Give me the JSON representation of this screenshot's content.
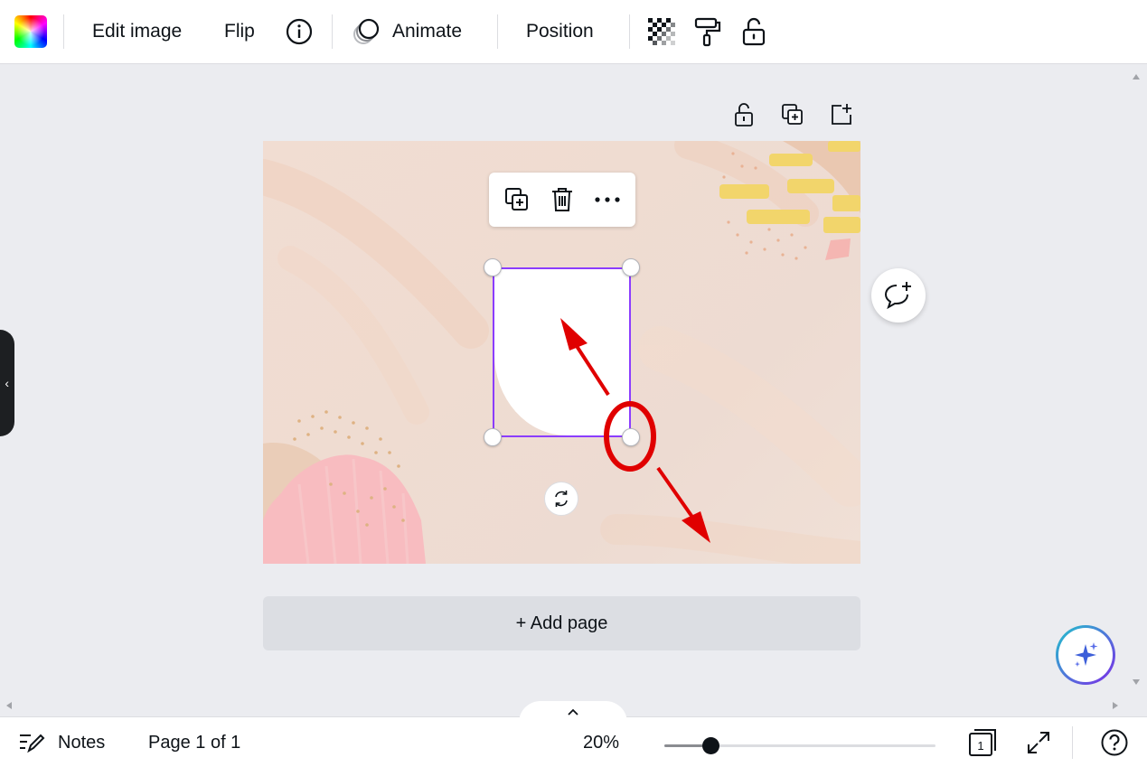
{
  "toolbar": {
    "edit_image": "Edit image",
    "flip": "Flip",
    "animate": "Animate",
    "position": "Position"
  },
  "canvas": {
    "add_page": "+ Add page"
  },
  "bottombar": {
    "notes": "Notes",
    "page_indicator": "Page 1 of 1",
    "zoom": "20%",
    "zoom_fraction": 0.17,
    "page_count": "1"
  },
  "colors": {
    "selection": "#8b3dff",
    "annotation": "#e00000"
  }
}
